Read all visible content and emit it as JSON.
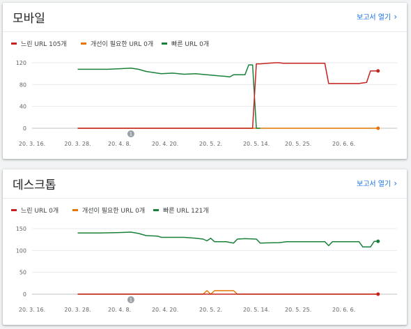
{
  "cards": [
    {
      "title": "모바일",
      "report_link": "보고서 열기",
      "legend": [
        "느린 URL 105개",
        "개선이 필요한 URL 0개",
        "빠른 URL 0개"
      ]
    },
    {
      "title": "데스크톱",
      "report_link": "보고서 열기",
      "legend": [
        "느린 URL 0개",
        "개선이 필요한 URL 0개",
        "빠른 URL 121개"
      ]
    }
  ],
  "colors": {
    "slow": "#c5221f",
    "needs_improvement": "#e37400",
    "fast": "#188038",
    "link": "#1a73e8",
    "annotation": "#9aa0a6"
  },
  "icons": {
    "report_link": "chevron-right-icon",
    "annotation": "annotation-marker-icon"
  },
  "chart_data": [
    {
      "type": "line",
      "x_tick_labels": [
        "20. 3. 16.",
        "20. 3. 28.",
        "20. 4. 8.",
        "20. 4. 20.",
        "20. 5. 2.",
        "20. 5. 14.",
        "20. 5. 25.",
        "20. 6. 6."
      ],
      "ylim": [
        0,
        120
      ],
      "y_ticks": [
        0,
        40,
        80,
        120
      ],
      "grid": true,
      "legend_position": "top-left",
      "annotation": {
        "x": "20. 4. 11.",
        "label": "1"
      },
      "series": [
        {
          "name": "느린 URL",
          "color_key": "slow",
          "points": [
            [
              "20. 3. 28.",
              0
            ],
            [
              "20. 5. 13.",
              0
            ],
            [
              "20. 5. 14.",
              118
            ],
            [
              "20. 5. 15.",
              118
            ],
            [
              "20. 5. 19.",
              120
            ],
            [
              "20. 5. 20.",
              120
            ],
            [
              "20. 5. 21.",
              119
            ],
            [
              "20. 6. 1.",
              119
            ],
            [
              "20. 6. 2.",
              82
            ],
            [
              "20. 6. 10.",
              82
            ],
            [
              "20. 6. 12.",
              84
            ],
            [
              "20. 6. 13.",
              105
            ],
            [
              "20. 6. 15.",
              105
            ]
          ]
        },
        {
          "name": "개선이 필요한 URL",
          "color_key": "needs_improvement",
          "points": [
            [
              "20. 3. 28.",
              0
            ],
            [
              "20. 6. 15.",
              0
            ]
          ]
        },
        {
          "name": "빠른 URL",
          "color_key": "fast",
          "points": [
            [
              "20. 3. 28.",
              108
            ],
            [
              "20. 4. 5.",
              108
            ],
            [
              "20. 4. 8.",
              109
            ],
            [
              "20. 4. 11.",
              110
            ],
            [
              "20. 4. 13.",
              108
            ],
            [
              "20. 4. 15.",
              104
            ],
            [
              "20. 4. 17.",
              102
            ],
            [
              "20. 4. 19.",
              100
            ],
            [
              "20. 4. 22.",
              101
            ],
            [
              "20. 4. 25.",
              99
            ],
            [
              "20. 4. 28.",
              100
            ],
            [
              "20. 5. 1.",
              98
            ],
            [
              "20. 5. 4.",
              96
            ],
            [
              "20. 5. 6.",
              95
            ],
            [
              "20. 5. 7.",
              94
            ],
            [
              "20. 5. 8.",
              98
            ],
            [
              "20. 5. 11.",
              98
            ],
            [
              "20. 5. 12.",
              116
            ],
            [
              "20. 5. 13.",
              116
            ],
            [
              "20. 5. 14.",
              0
            ],
            [
              "20. 5. 15.",
              0
            ]
          ]
        }
      ]
    },
    {
      "type": "line",
      "x_tick_labels": [
        "20. 3. 16.",
        "20. 3. 28.",
        "20. 4. 8.",
        "20. 4. 20.",
        "20. 5. 2.",
        "20. 5. 14.",
        "20. 5. 25.",
        "20. 6. 6."
      ],
      "ylim": [
        0,
        150
      ],
      "y_ticks": [
        0,
        50,
        100,
        150
      ],
      "grid": true,
      "legend_position": "top-left",
      "annotation": {
        "x": "20. 4. 11.",
        "label": "1"
      },
      "series": [
        {
          "name": "느린 URL",
          "color_key": "slow",
          "points": [
            [
              "20. 3. 28.",
              0
            ],
            [
              "20. 6. 15.",
              0
            ]
          ]
        },
        {
          "name": "개선이 필요한 URL",
          "color_key": "needs_improvement",
          "points": [
            [
              "20. 3. 28.",
              0
            ],
            [
              "20. 4. 30.",
              0
            ],
            [
              "20. 5. 1.",
              8
            ],
            [
              "20. 5. 2.",
              0
            ],
            [
              "20. 5. 3.",
              8
            ],
            [
              "20. 5. 8.",
              8
            ],
            [
              "20. 5. 9.",
              0
            ],
            [
              "20. 6. 15.",
              0
            ]
          ]
        },
        {
          "name": "빠른 URL",
          "color_key": "fast",
          "points": [
            [
              "20. 3. 28.",
              140
            ],
            [
              "20. 4. 3.",
              140
            ],
            [
              "20. 4. 8.",
              141
            ],
            [
              "20. 4. 11.",
              142
            ],
            [
              "20. 4. 13.",
              139
            ],
            [
              "20. 4. 15.",
              134
            ],
            [
              "20. 4. 18.",
              133
            ],
            [
              "20. 4. 19.",
              130
            ],
            [
              "20. 4. 25.",
              130
            ],
            [
              "20. 4. 28.",
              128
            ],
            [
              "20. 4. 30.",
              126
            ],
            [
              "20. 5. 1.",
              122
            ],
            [
              "20. 5. 2.",
              128
            ],
            [
              "20. 5. 3.",
              120
            ],
            [
              "20. 5. 6.",
              120
            ],
            [
              "20. 5. 8.",
              117
            ],
            [
              "20. 5. 9.",
              126
            ],
            [
              "20. 5. 11.",
              127
            ],
            [
              "20. 5. 14.",
              126
            ],
            [
              "20. 5. 15.",
              117
            ],
            [
              "20. 5. 20.",
              118
            ],
            [
              "20. 5. 22.",
              120
            ],
            [
              "20. 6. 1.",
              120
            ],
            [
              "20. 6. 2.",
              111
            ],
            [
              "20. 6. 3.",
              120
            ],
            [
              "20. 6. 10.",
              120
            ],
            [
              "20. 6. 11.",
              108
            ],
            [
              "20. 6. 13.",
              108
            ],
            [
              "20. 6. 14.",
              121
            ],
            [
              "20. 6. 15.",
              121
            ]
          ]
        }
      ]
    }
  ]
}
